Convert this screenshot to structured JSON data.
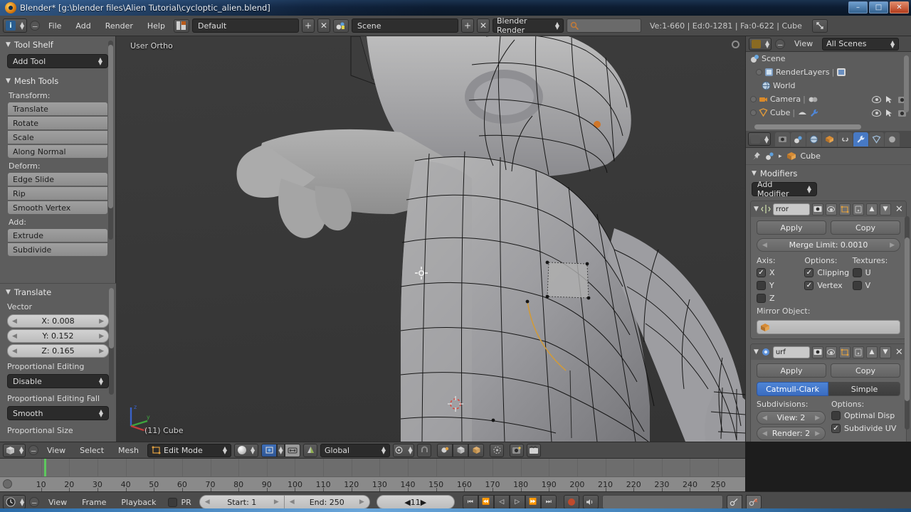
{
  "window": {
    "title": "Blender* [g:\\blender files\\Alien Tutorial\\cycloptic_alien.blend]",
    "minimize": "–",
    "maximize": "□",
    "close": "✕"
  },
  "info_header": {
    "editor_icon": "info-editor-icon",
    "menus": [
      "File",
      "Add",
      "Render",
      "Help"
    ],
    "screen_layout": "Default",
    "screen_add": "+",
    "screen_remove": "✕",
    "scene_name": "Scene",
    "scene_add": "+",
    "scene_remove": "✕",
    "engine": "Blender Render",
    "search_placeholder": "",
    "status": "Ve:1-660 | Ed:0-1281 | Fa:0-622 | Cube"
  },
  "tool_shelf": {
    "title": "Tool Shelf",
    "add_tool": "Add Tool",
    "mesh_tools_title": "Mesh Tools",
    "groups": [
      {
        "label": "Transform:",
        "buttons": [
          "Translate",
          "Rotate",
          "Scale",
          "Along Normal"
        ]
      },
      {
        "label": "Deform:",
        "buttons": [
          "Edge Slide",
          "Rip",
          "Smooth Vertex"
        ]
      },
      {
        "label": "Add:",
        "buttons": [
          "Extrude",
          "Subdivide"
        ]
      }
    ]
  },
  "translate_panel": {
    "title": "Translate",
    "vector_label": "Vector",
    "vector": [
      "X: 0.008",
      "Y: 0.152",
      "Z: 0.165"
    ],
    "prop_edit_label": "Proportional Editing",
    "prop_edit_value": "Disable",
    "prop_fall_label": "Proportional Editing Fall",
    "prop_fall_value": "Smooth",
    "prop_size_label": "Proportional Size"
  },
  "viewport": {
    "view_name": "User Ortho",
    "object_label": "(11) Cube",
    "axis_x": "x",
    "axis_y": "y",
    "axis_z": "z"
  },
  "outliner": {
    "view_menu": "View",
    "display_mode": "All Scenes",
    "rows": [
      {
        "label": "Scene",
        "indent": 0,
        "icon": "scene-icon",
        "expander": false,
        "eye": false
      },
      {
        "label": "RenderLayers",
        "indent": 1,
        "icon": "renderlayers-icon",
        "expander": true,
        "eye": false
      },
      {
        "label": "World",
        "indent": 1,
        "icon": "world-icon",
        "expander": false,
        "eye": false
      },
      {
        "label": "Camera",
        "indent": 0,
        "icon": "camera-icon",
        "expander": true,
        "eye": true
      },
      {
        "label": "Cube",
        "indent": 0,
        "icon": "mesh-icon",
        "expander": true,
        "eye": true
      }
    ]
  },
  "properties": {
    "tabs": [
      {
        "name": "render-tab",
        "glyph": "▣",
        "active": false
      },
      {
        "name": "scene-tab",
        "glyph": "◑",
        "active": false
      },
      {
        "name": "world-tab",
        "glyph": "●",
        "active": false
      },
      {
        "name": "object-tab",
        "glyph": "■",
        "active": false
      },
      {
        "name": "constraint-tab",
        "glyph": "⚭",
        "active": false
      },
      {
        "name": "modifier-tab",
        "glyph": "⚒",
        "active": true
      },
      {
        "name": "data-tab",
        "glyph": "▽",
        "active": false
      },
      {
        "name": "material-tab",
        "glyph": "●",
        "active": false
      }
    ],
    "breadcrumb_object": "Cube",
    "modifiers_title": "Modifiers",
    "add_modifier": "Add Modifier",
    "modifier_list": [
      {
        "name": "mirror-modifier",
        "display_name": "rror",
        "apply": "Apply",
        "copy": "Copy",
        "merge_limit": "Merge Limit: 0.0010",
        "columns": [
          {
            "header": "Axis:",
            "items": [
              {
                "label": "X",
                "checked": true
              },
              {
                "label": "Y",
                "checked": false
              },
              {
                "label": "Z",
                "checked": false
              }
            ]
          },
          {
            "header": "Options:",
            "items": [
              {
                "label": "Clipping",
                "checked": true
              },
              {
                "label": "Vertex",
                "checked": true
              }
            ]
          },
          {
            "header": "Textures:",
            "items": [
              {
                "label": "U",
                "checked": false
              },
              {
                "label": "V",
                "checked": false
              }
            ]
          }
        ],
        "mirror_object_label": "Mirror Object:",
        "mirror_object_value": ""
      },
      {
        "name": "subsurf-modifier",
        "display_name": "urf",
        "apply": "Apply",
        "copy": "Copy",
        "algorithms": [
          {
            "label": "Catmull-Clark",
            "active": true
          },
          {
            "label": "Simple",
            "active": false
          }
        ],
        "subdivisions_label": "Subdivisions:",
        "options_label": "Options:",
        "view": "View: 2",
        "render": "Render: 2",
        "optimal_disp": {
          "label": "Optimal Disp",
          "checked": false
        },
        "subdivide_uv": {
          "label": "Subdivide UV",
          "checked": true
        }
      }
    ]
  },
  "viewport_header": {
    "menus": [
      "View",
      "Select",
      "Mesh"
    ],
    "mode": "Edit Mode",
    "orientation": "Global"
  },
  "timeline": {
    "ticks": [
      10,
      20,
      30,
      40,
      50,
      60,
      70,
      80,
      90,
      100,
      110,
      120,
      130,
      140,
      150,
      160,
      170,
      180,
      190,
      200,
      210,
      220,
      230,
      240,
      250
    ],
    "current_frame_marker": 11,
    "menus": [
      "View",
      "Frame",
      "Playback"
    ],
    "pr_label": "PR",
    "start": "Start: 1",
    "end": "End: 250",
    "frame": "11",
    "transport": [
      "⏮",
      "⏪",
      "◁",
      "▷",
      "⏩",
      "⏭"
    ]
  },
  "colors": {
    "accent_blue": "#4779c4",
    "header_grey": "#4b4b4b",
    "panel_grey": "#5c5c5c",
    "viewport_bg": "#3a3a3a",
    "playhead_green": "#5ec85e"
  }
}
